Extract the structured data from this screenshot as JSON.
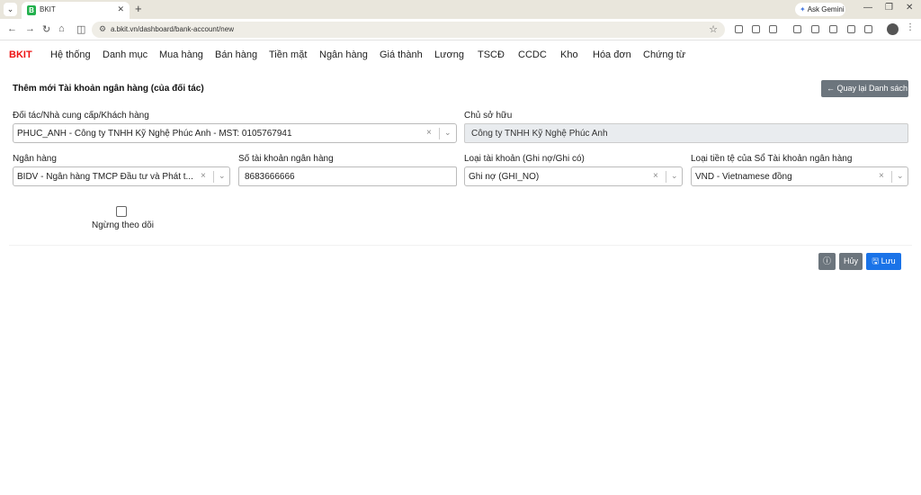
{
  "browser": {
    "tab_title": "BKIT",
    "tab_favicon": "B",
    "new_tab": "+",
    "url": "a.bkit.vn/dashboard/bank-account/new",
    "gemini_label": "Ask Gemini"
  },
  "app": {
    "brand": "BKIT",
    "menu": [
      "Hệ thống",
      "Danh mục",
      "Mua hàng",
      "Bán hàng",
      "Tiền mặt",
      "Ngân hàng",
      "Giá thành",
      "Lương",
      "TSCĐ",
      "CCDC",
      "Kho",
      "Hóa đơn",
      "Chứng từ"
    ]
  },
  "page": {
    "title": "Thêm mới Tài khoản ngân hàng (của đối tác)",
    "back_button": "Quay lại Danh sách"
  },
  "form": {
    "partner_label": "Đối tác/Nhà cung cấp/Khách hàng",
    "partner_value": "PHUC_ANH - Công ty TNHH Kỹ Nghệ Phúc Anh - MST: 0105767941",
    "owner_label": "Chủ sở hữu",
    "owner_value": "Công ty TNHH Kỹ Nghệ Phúc Anh",
    "bank_label": "Ngân hàng",
    "bank_value": "BIDV - Ngân hàng TMCP Đầu tư và Phát t...",
    "account_no_label": "Số tài khoản ngân hàng",
    "account_no_value": "8683666666",
    "account_type_label": "Loại tài khoản (Ghi nợ/Ghi có)",
    "account_type_value": "Ghi nợ (GHI_NO)",
    "currency_label": "Loại tiền tệ của Sổ Tài khoản ngân hàng",
    "currency_value": "VND - Vietnamese đồng",
    "inactive_label": "Ngừng theo dõi",
    "inactive_checked": false
  },
  "actions": {
    "cancel": "Hủy",
    "save": "Lưu"
  }
}
